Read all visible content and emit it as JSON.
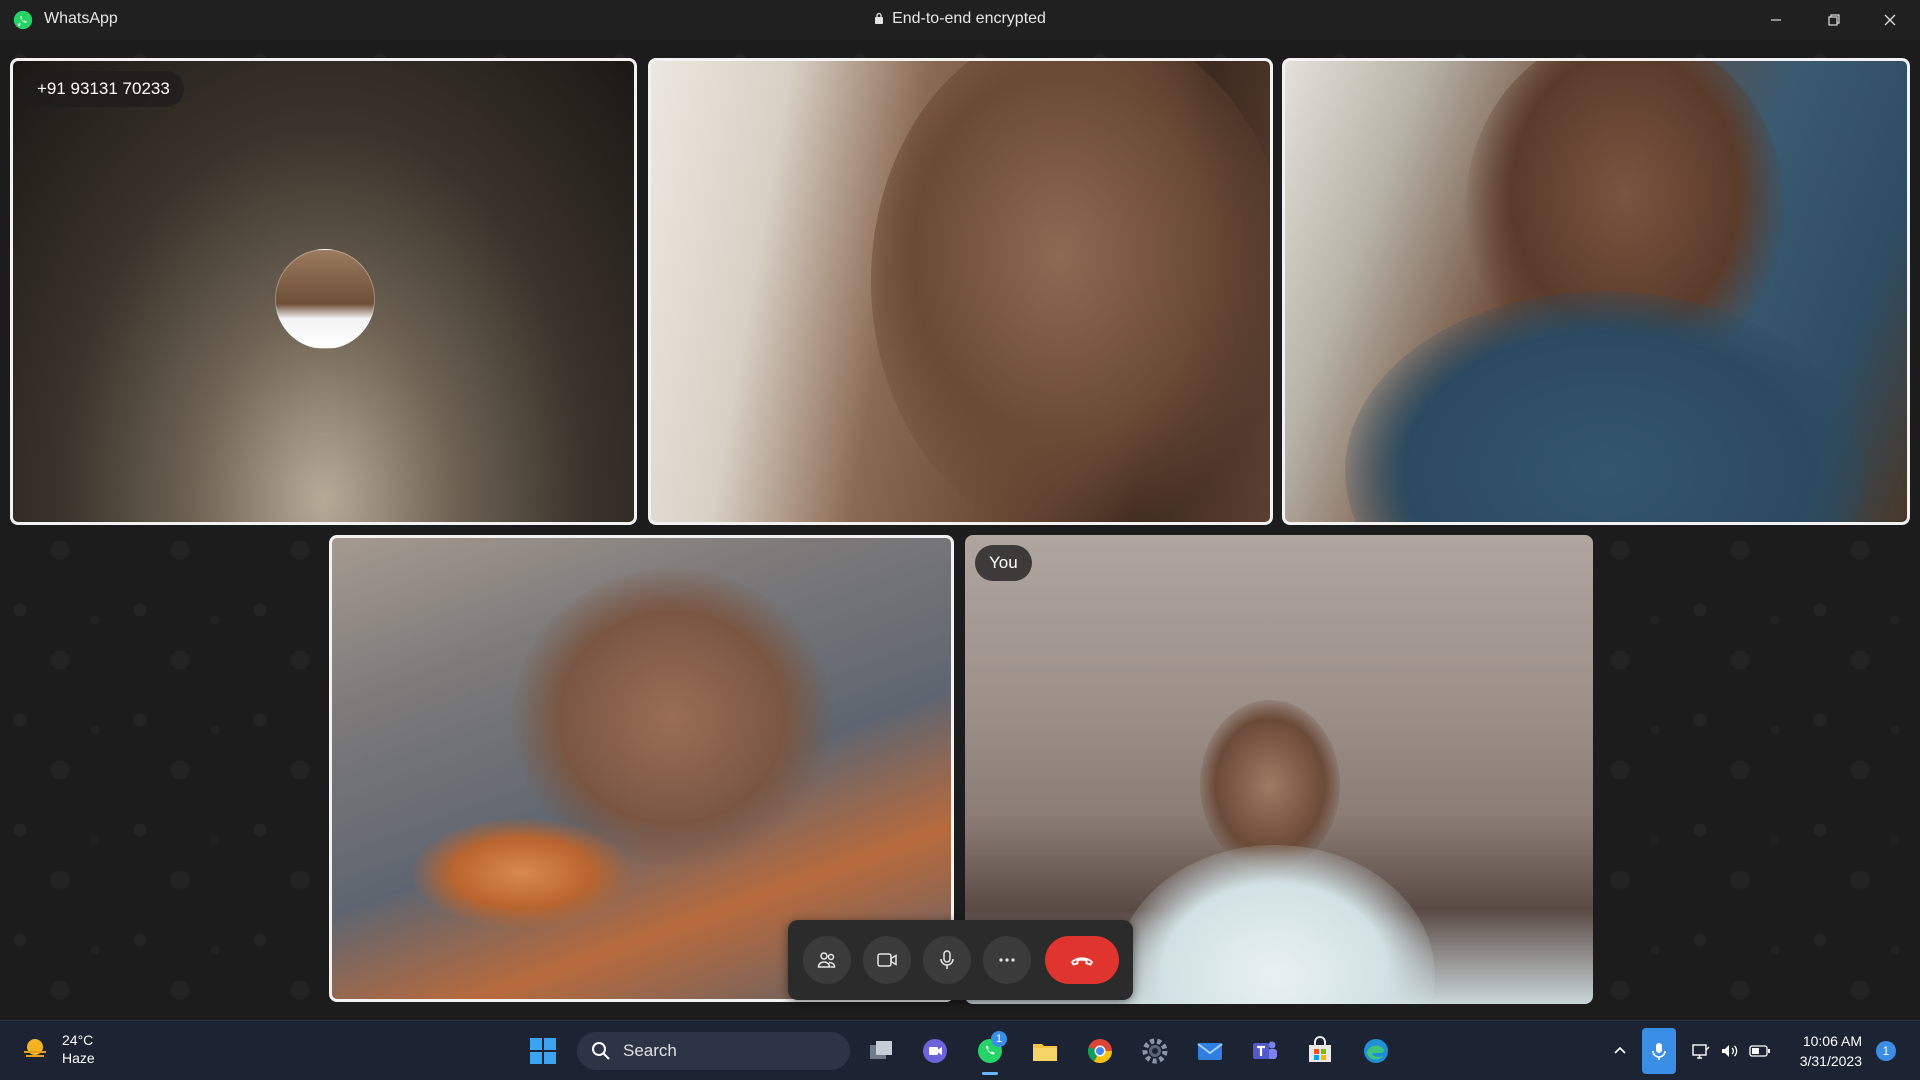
{
  "window": {
    "app_title": "WhatsApp",
    "encryption_label": "End-to-end encrypted",
    "icons": [
      "whatsapp-logo",
      "lock-icon",
      "minimize-icon",
      "restore-icon",
      "close-icon"
    ]
  },
  "call": {
    "participants": [
      {
        "label": "+91 93131 70233",
        "video": false
      },
      {
        "label": "",
        "video": true
      },
      {
        "label": "",
        "video": true
      },
      {
        "label": "",
        "video": true
      },
      {
        "label": "You",
        "video": true
      }
    ],
    "controls": [
      "participants-icon",
      "video-icon",
      "mic-icon",
      "more-icon",
      "end-call-icon"
    ],
    "end_call_color": "#e0342f"
  },
  "taskbar": {
    "weather": {
      "temp": "24°C",
      "condition": "Haze"
    },
    "search_label": "Search",
    "whatsapp_badge": "1",
    "time": "10:06 AM",
    "date": "3/31/2023",
    "notification_count": "1",
    "apps": [
      "start",
      "search",
      "task-view",
      "chat",
      "whatsapp",
      "file-explorer",
      "chrome",
      "settings",
      "mail",
      "teams",
      "store",
      "edge"
    ]
  }
}
